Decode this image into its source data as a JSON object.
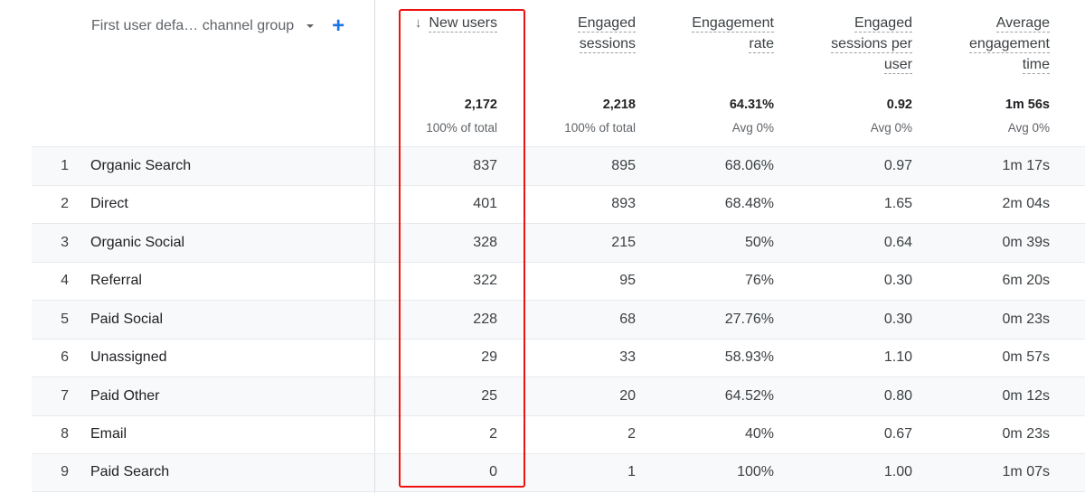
{
  "dimension": {
    "label": "First user defa… channel group",
    "dropdown_icon": "caret-down-icon",
    "add_icon": "plus-icon"
  },
  "metrics": [
    {
      "key": "new_users",
      "label_lines": [
        "New users"
      ],
      "sorted": true,
      "sort_icon": "arrow-down-icon",
      "total": "2,172",
      "sub": "100% of total"
    },
    {
      "key": "engaged_sessions",
      "label_lines": [
        "Engaged",
        "sessions"
      ],
      "sorted": false,
      "total": "2,218",
      "sub": "100% of total"
    },
    {
      "key": "engagement_rate",
      "label_lines": [
        "Engagement",
        "rate"
      ],
      "sorted": false,
      "total": "64.31%",
      "sub": "Avg 0%"
    },
    {
      "key": "engaged_sessions_per_user",
      "label_lines": [
        "Engaged",
        "sessions per",
        "user"
      ],
      "sorted": false,
      "total": "0.92",
      "sub": "Avg 0%"
    },
    {
      "key": "avg_engagement_time",
      "label_lines": [
        "Average",
        "engagement",
        "time"
      ],
      "sorted": false,
      "total": "1m 56s",
      "sub": "Avg 0%"
    }
  ],
  "rows": [
    {
      "rank": "1",
      "name": "Organic Search",
      "values": [
        "837",
        "895",
        "68.06%",
        "0.97",
        "1m 17s"
      ]
    },
    {
      "rank": "2",
      "name": "Direct",
      "values": [
        "401",
        "893",
        "68.48%",
        "1.65",
        "2m 04s"
      ]
    },
    {
      "rank": "3",
      "name": "Organic Social",
      "values": [
        "328",
        "215",
        "50%",
        "0.64",
        "0m 39s"
      ]
    },
    {
      "rank": "4",
      "name": "Referral",
      "values": [
        "322",
        "95",
        "76%",
        "0.30",
        "6m 20s"
      ]
    },
    {
      "rank": "5",
      "name": "Paid Social",
      "values": [
        "228",
        "68",
        "27.76%",
        "0.30",
        "0m 23s"
      ]
    },
    {
      "rank": "6",
      "name": "Unassigned",
      "values": [
        "29",
        "33",
        "58.93%",
        "1.10",
        "0m 57s"
      ]
    },
    {
      "rank": "7",
      "name": "Paid Other",
      "values": [
        "25",
        "20",
        "64.52%",
        "0.80",
        "0m 12s"
      ]
    },
    {
      "rank": "8",
      "name": "Email",
      "values": [
        "2",
        "2",
        "40%",
        "0.67",
        "0m 23s"
      ]
    },
    {
      "rank": "9",
      "name": "Paid Search",
      "values": [
        "0",
        "1",
        "100%",
        "1.00",
        "1m 07s"
      ]
    }
  ],
  "colors": {
    "accent": "#1a73e8",
    "highlight_box": "#ee1111",
    "row_alt_bg": "#f8f9fa",
    "divider": "#dadce0"
  },
  "highlight": {
    "column": "new_users"
  }
}
